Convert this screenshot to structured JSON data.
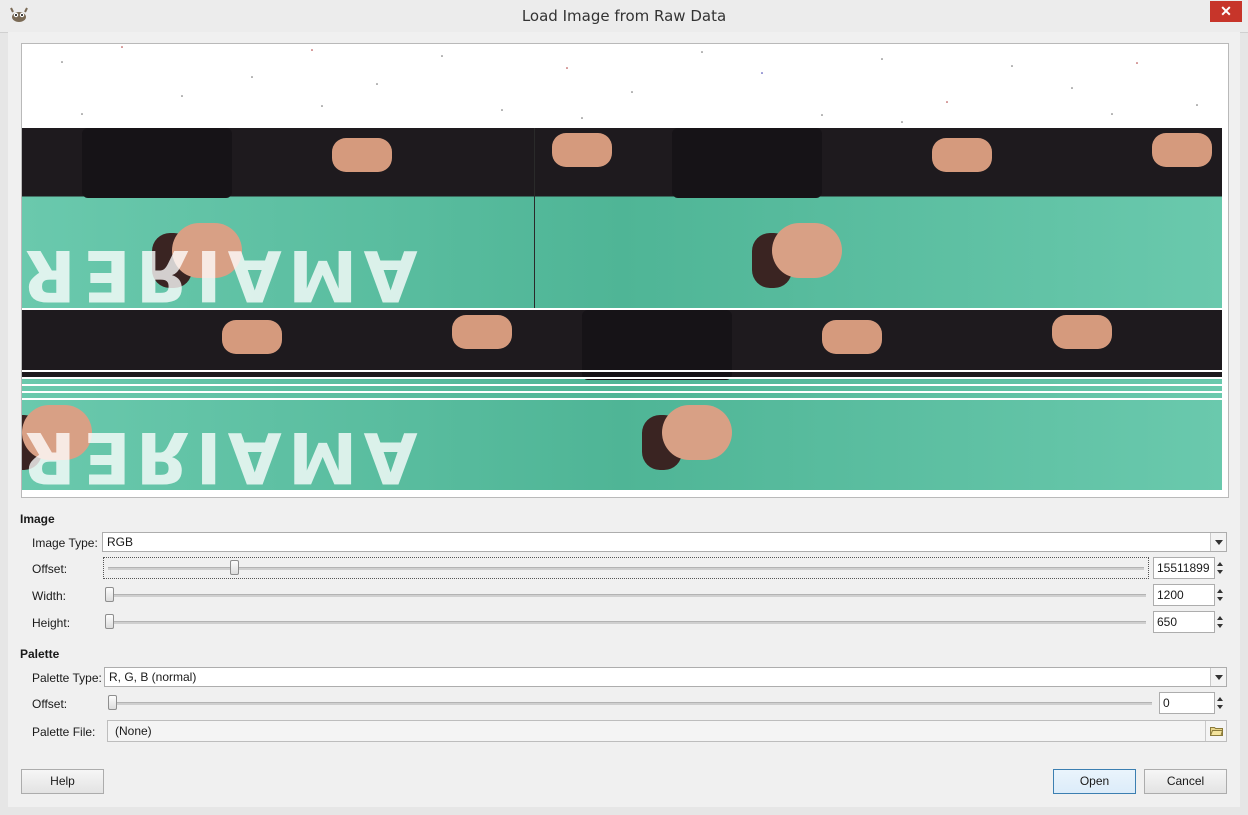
{
  "window": {
    "title": "Load Image from Raw Data",
    "close_glyph": "✕"
  },
  "image_section": {
    "title": "Image",
    "image_type": {
      "label": "Image Type:",
      "underline": "T",
      "value": "RGB"
    },
    "offset": {
      "label": "Offset:",
      "value": "15511899",
      "level": 0.11
    },
    "width": {
      "label": "Width:",
      "value": "1200",
      "level": 0.0
    },
    "height": {
      "label": "Height:",
      "value": "650",
      "level": 0.0
    }
  },
  "palette_section": {
    "title": "Palette",
    "palette_type": {
      "label": "Palette Type:",
      "value": "R, G, B (normal)"
    },
    "offset": {
      "label": "Offset:",
      "value": "0",
      "level": 0.0
    },
    "palette_file": {
      "label": "Palette File:",
      "value": "(None)"
    }
  },
  "buttons": {
    "help": "Help",
    "open": "Open",
    "cancel": "Cancel"
  },
  "preview": {
    "watermark_text": "ЯƎRIAMA"
  },
  "icons": {
    "app": "gimp-icon",
    "folder": "folder-open-icon",
    "dropdown": "chevron-down-icon"
  }
}
